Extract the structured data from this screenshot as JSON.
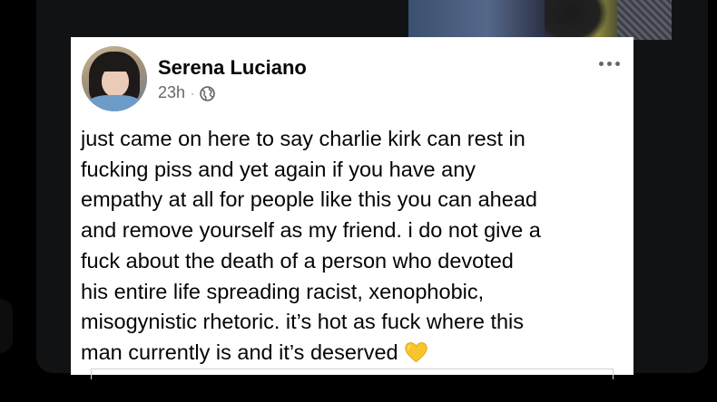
{
  "post": {
    "author_name": "Serena Luciano",
    "timestamp": "23h",
    "separator": "·",
    "privacy_icon": "globe-icon",
    "menu_icon": "more-options-icon",
    "text_lines": [
      "just came on here to say charlie kirk can rest in",
      "fucking piss and yet again if you have any",
      "empathy at all for people like this you can ahead",
      "and remove yourself as my friend. i do not give a",
      "fuck about the death of a person who devoted",
      "his entire life spreading racist, xenophobic,",
      "misogynistic rhetoric. it’s hot as fuck where this",
      "man currently is and it’s deserved"
    ],
    "trailing_emoji": "yellow-heart-emoji"
  },
  "colors": {
    "background": "#000000",
    "card": "#ffffff",
    "text": "#050505",
    "secondary_text": "#65676b",
    "heart": "#f7c52b"
  }
}
